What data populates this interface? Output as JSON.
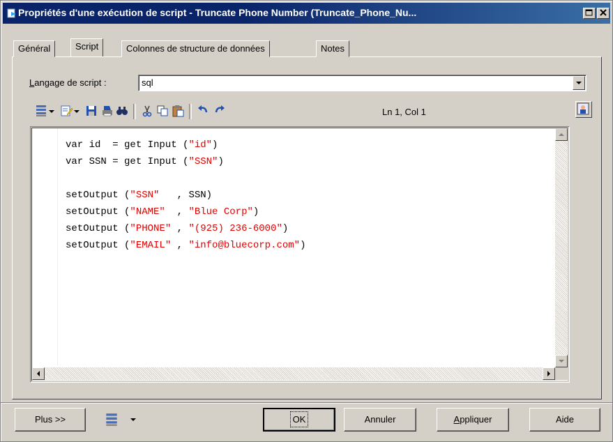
{
  "window": {
    "title": "Propriétés d'une exécution de script - Truncate Phone Number (Truncate_Phone_Nu..."
  },
  "tabs": [
    {
      "label": "Général"
    },
    {
      "label": "Script"
    },
    {
      "label": "Colonnes de structure de données"
    },
    {
      "label": "Notes"
    }
  ],
  "form": {
    "language_label_underlined": "L",
    "language_label_rest": "angage de script :",
    "language_value": "sql"
  },
  "toolbar": {
    "position": "Ln 1, Col 1",
    "icons": [
      "insert-icon",
      "edit-icon",
      "save-icon",
      "print-icon",
      "find-icon",
      "cut-icon",
      "copy-icon",
      "paste-icon",
      "undo-icon",
      "redo-icon"
    ]
  },
  "code": {
    "lines": [
      {
        "parts": [
          {
            "t": "var id  = get Input (",
            "s": false
          },
          {
            "t": "\"id\"",
            "s": true
          },
          {
            "t": ")",
            "s": false
          }
        ]
      },
      {
        "parts": [
          {
            "t": "var SSN = get Input (",
            "s": false
          },
          {
            "t": "\"SSN\"",
            "s": true
          },
          {
            "t": ")",
            "s": false
          }
        ]
      },
      {
        "parts": [
          {
            "t": "",
            "s": false
          }
        ]
      },
      {
        "parts": [
          {
            "t": "setOutput (",
            "s": false
          },
          {
            "t": "\"SSN\"",
            "s": true
          },
          {
            "t": "   , SSN)",
            "s": false
          }
        ]
      },
      {
        "parts": [
          {
            "t": "setOutput (",
            "s": false
          },
          {
            "t": "\"NAME\"",
            "s": true
          },
          {
            "t": "  , ",
            "s": false
          },
          {
            "t": "\"Blue Corp\"",
            "s": true
          },
          {
            "t": ")",
            "s": false
          }
        ]
      },
      {
        "parts": [
          {
            "t": "setOutput (",
            "s": false
          },
          {
            "t": "\"PHONE\"",
            "s": true
          },
          {
            "t": " , ",
            "s": false
          },
          {
            "t": "\"(925) 236-6000\"",
            "s": true
          },
          {
            "t": ")",
            "s": false
          }
        ]
      },
      {
        "parts": [
          {
            "t": "setOutput (",
            "s": false
          },
          {
            "t": "\"EMAIL\"",
            "s": true
          },
          {
            "t": " , ",
            "s": false
          },
          {
            "t": "\"info@bluecorp.com\"",
            "s": true
          },
          {
            "t": ")",
            "s": false
          }
        ]
      }
    ],
    "string_color": "#e00000"
  },
  "buttons": {
    "more": "Plus >>",
    "ok": "OK",
    "cancel": "Annuler",
    "apply_underlined": "A",
    "apply_rest": "ppliquer",
    "help": "Aide"
  }
}
